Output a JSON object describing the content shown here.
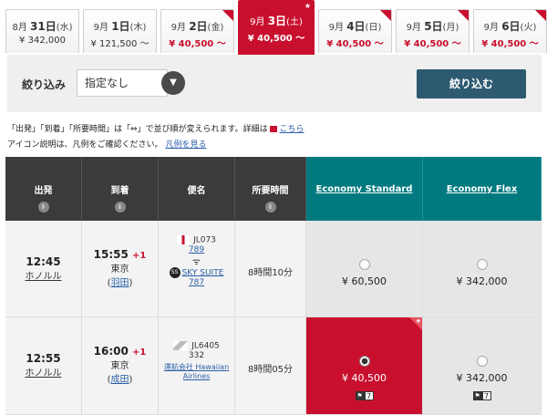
{
  "tabs": [
    {
      "date_pre": "8月",
      "day": "31日",
      "dow": "(水)",
      "price": "¥ 342,000",
      "style": "black",
      "corner": false
    },
    {
      "date_pre": "9月",
      "day": "1日",
      "dow": "(木)",
      "price": "¥ 121,500 ～",
      "style": "black",
      "corner": false
    },
    {
      "date_pre": "9月",
      "day": "2日",
      "dow": "(金)",
      "price": "¥ 40,500 ～",
      "style": "red",
      "corner": true
    },
    {
      "date_pre": "9月",
      "day": "3日",
      "dow": "(土)",
      "price": "¥ 40,500 ～",
      "style": "active",
      "corner": false
    },
    {
      "date_pre": "9月",
      "day": "4日",
      "dow": "(日)",
      "price": "¥ 40,500 ～",
      "style": "red",
      "corner": true
    },
    {
      "date_pre": "9月",
      "day": "5日",
      "dow": "(月)",
      "price": "¥ 40,500 ～",
      "style": "red",
      "corner": true
    },
    {
      "date_pre": "9月",
      "day": "6日",
      "dow": "(火)",
      "price": "¥ 40,500 ～",
      "style": "red",
      "corner": true
    }
  ],
  "filter": {
    "label": "絞り込み",
    "select_value": "指定なし",
    "apply_label": "絞り込む"
  },
  "notes": {
    "line1_text": "「出発」「到着」「所要時間」は「⇔」で並び順が変えられます。詳細は",
    "line1_link": "こちら",
    "line2_text": "アイコン説明は、凡例をご確認ください。",
    "line2_link": "凡例を見る"
  },
  "table": {
    "headers": {
      "depart": "出発",
      "arrive": "到着",
      "flight": "便名",
      "duration": "所要時間",
      "fare1": "Economy Standard",
      "fare2": "Economy Flex"
    },
    "rows": [
      {
        "dep_time": "12:45",
        "dep_city": "ホノルル",
        "arr_time": "15:55",
        "arr_plus": "+1",
        "arr_city": "東京",
        "arr_airport": "羽田",
        "flight_no": "JL073",
        "aircraft": "789",
        "seat_name": "SKY SUITE",
        "seat_code": "787",
        "duration": "8時間10分",
        "fare1_price": "¥ 60,500",
        "fare2_price": "¥ 342,000"
      },
      {
        "dep_time": "12:55",
        "dep_city": "ホノルル",
        "arr_time": "16:00",
        "arr_plus": "+1",
        "arr_city": "東京",
        "arr_airport": "成田",
        "flight_no": "JL6405",
        "aircraft": "332",
        "operator": "運航会社 Hawaiian Airlines",
        "duration": "8時間05分",
        "fare1_price": "¥ 40,500",
        "fare1_seats": "7",
        "fare2_price": "¥ 342,000",
        "fare2_seats": "7"
      }
    ]
  },
  "colors": {
    "accent_red": "#c8102e",
    "teal": "#007a7f",
    "dark_header": "#3b3b3b",
    "button_blue": "#2d5a70"
  }
}
